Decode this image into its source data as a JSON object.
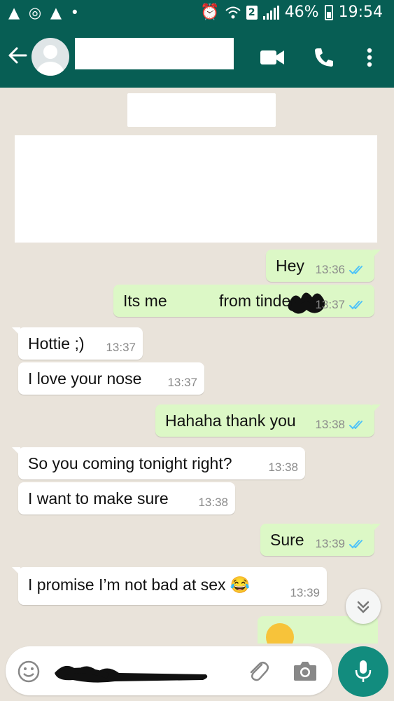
{
  "status_bar": {
    "left_icons": "▲ ◎ ▲ •",
    "sim": "2",
    "battery": "46%",
    "time": "19:54"
  },
  "header": {
    "contact_name": ""
  },
  "messages": [
    {
      "dir": "out",
      "text": "Hey",
      "time": "13:36",
      "read": true
    },
    {
      "dir": "out",
      "text_before": "Its me",
      "text_after": "from tinder",
      "time": "13:37",
      "read": true
    },
    {
      "dir": "in",
      "text": "Hottie ;)",
      "time": "13:37"
    },
    {
      "dir": "in",
      "text": "I love your nose",
      "time": "13:37"
    },
    {
      "dir": "out",
      "text": "Hahaha thank you",
      "time": "13:38",
      "read": true
    },
    {
      "dir": "in",
      "text": "So you coming tonight right?",
      "time": "13:38"
    },
    {
      "dir": "in",
      "text": "I want to make sure",
      "time": "13:38"
    },
    {
      "dir": "out",
      "text": "Sure",
      "time": "13:39",
      "read": true
    },
    {
      "dir": "in",
      "text": "I promise I’m not bad at sex 😂",
      "time": "13:39"
    }
  ],
  "colors": {
    "header": "#075e54",
    "outgoing_bubble": "#dcf8c6",
    "incoming_bubble": "#ffffff",
    "read_ticks": "#4fc3f7",
    "mic_button": "#128c7e",
    "chat_background": "#e9e3da"
  },
  "icons": [
    "back-arrow-icon",
    "video-call-icon",
    "voice-call-icon",
    "more-options-icon",
    "double-check-icon",
    "scroll-down-icon",
    "emoji-icon",
    "attach-icon",
    "camera-icon",
    "mic-icon"
  ]
}
